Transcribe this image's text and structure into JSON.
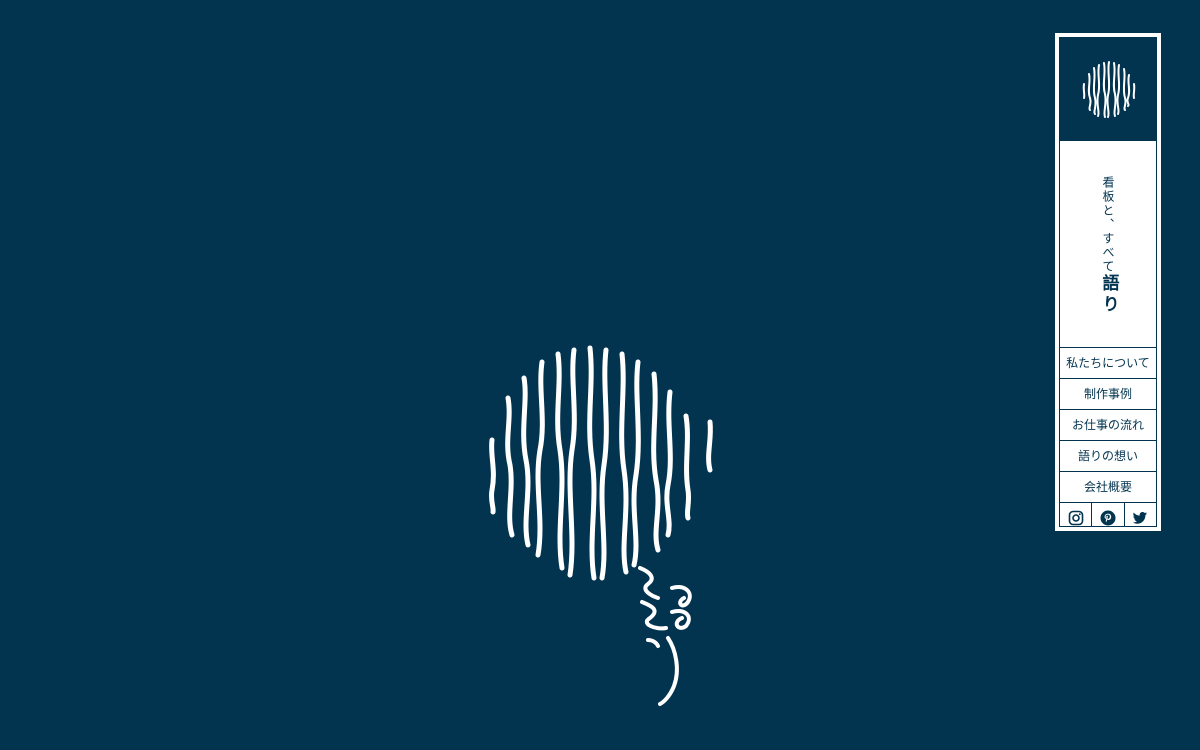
{
  "hero": {
    "brand_mark": "語り"
  },
  "side_panel": {
    "tagline": "看板と、すべて",
    "brand": "語り",
    "nav_items": [
      {
        "label": "私たちについて"
      },
      {
        "label": "制作事例"
      },
      {
        "label": "お仕事の流れ"
      },
      {
        "label": "語りの想い"
      },
      {
        "label": "会社概要"
      }
    ],
    "social": [
      {
        "icon": "instagram-icon"
      },
      {
        "icon": "pinterest-icon"
      },
      {
        "icon": "twitter-icon"
      }
    ]
  },
  "colors": {
    "background": "#02334f",
    "accent": "#ffffff"
  }
}
